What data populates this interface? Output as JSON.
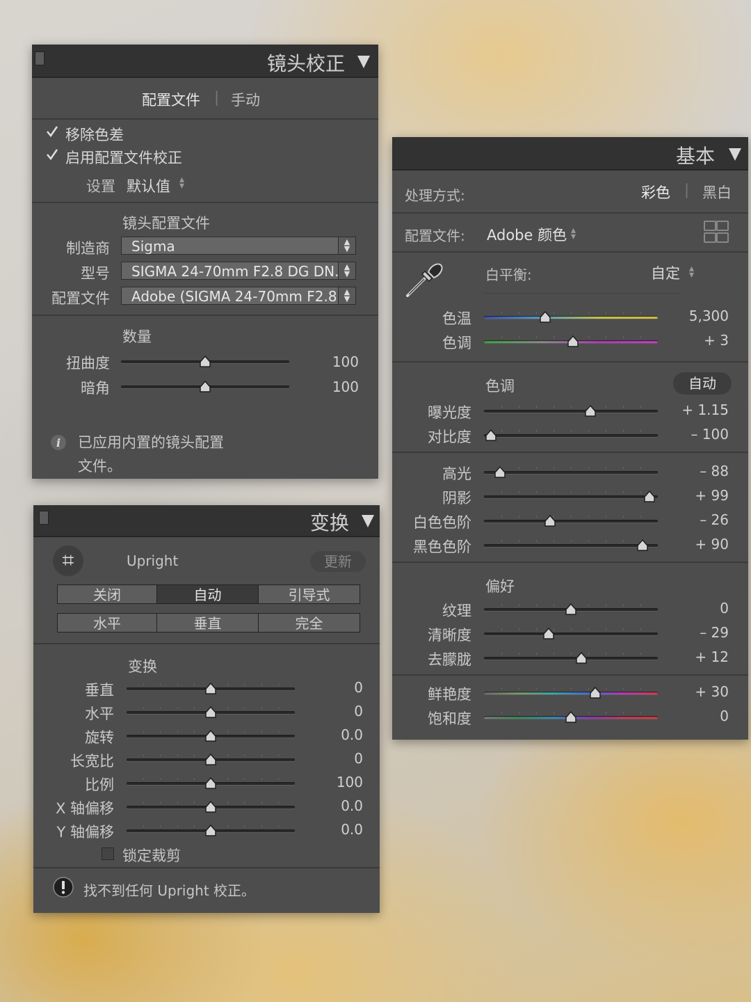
{
  "lens": {
    "title": "镜头校正",
    "tabs": [
      "配置文件",
      "手动"
    ],
    "remove_ca": "移除色差",
    "enable_profile": "启用配置文件校正",
    "setup_label": "设置",
    "setup_value": "默认值",
    "profile_heading": "镜头配置文件",
    "make_label": "制造商",
    "make_value": "Sigma",
    "model_label": "型号",
    "model_value": "SIGMA 24-70mm F2.8 DG DN...",
    "profile_label": "配置文件",
    "profile_value": "Adobe (SIGMA 24-70mm F2.8...",
    "amount_heading": "数量",
    "sliders": [
      {
        "label": "扭曲度",
        "value": "100",
        "pos": 0.5
      },
      {
        "label": "暗角",
        "value": "100",
        "pos": 0.5
      }
    ],
    "info": [
      "已应用内置的镜头配置",
      "文件。"
    ]
  },
  "transform": {
    "title": "变换",
    "upright_label": "Upright",
    "update_label": "更新",
    "buttons_row1": [
      "关闭",
      "自动",
      "引导式"
    ],
    "buttons_row2": [
      "水平",
      "垂直",
      "完全"
    ],
    "selected": "自动",
    "heading": "变换",
    "sliders": [
      {
        "label": "垂直",
        "value": "0",
        "pos": 0.5
      },
      {
        "label": "水平",
        "value": "0",
        "pos": 0.5
      },
      {
        "label": "旋转",
        "value": "0.0",
        "pos": 0.5
      },
      {
        "label": "长宽比",
        "value": "0",
        "pos": 0.5
      },
      {
        "label": "比例",
        "value": "100",
        "pos": 0.5
      },
      {
        "label": "X 轴偏移",
        "value": "0.0",
        "pos": 0.5
      },
      {
        "label": "Y 轴偏移",
        "value": "0.0",
        "pos": 0.5
      }
    ],
    "lock_crop": "锁定裁剪",
    "warning": "找不到任何 Upright 校正。"
  },
  "basic": {
    "title": "基本",
    "treatment_label": "处理方式:",
    "color_label": "彩色",
    "bw_label": "黑白",
    "profile_label": "配置文件:",
    "profile_value": "Adobe 颜色",
    "wb_label": "白平衡:",
    "wb_value": "自定",
    "wb_sliders": [
      {
        "label": "色温",
        "value": "5,300",
        "pos": 0.35
      },
      {
        "label": "色调",
        "value": "+ 3",
        "pos": 0.51
      }
    ],
    "tone_heading": "色调",
    "auto_label": "自动",
    "tone_sliders": [
      {
        "label": "曝光度",
        "value": "+ 1.15",
        "pos": 0.61
      },
      {
        "label": "对比度",
        "value": "– 100",
        "pos": 0.04
      }
    ],
    "presence_sliders": [
      {
        "label": "高光",
        "value": "– 88",
        "pos": 0.09
      },
      {
        "label": "阴影",
        "value": "+ 99",
        "pos": 0.95
      },
      {
        "label": "白色色阶",
        "value": "– 26",
        "pos": 0.38
      },
      {
        "label": "黑色色阶",
        "value": "+ 90",
        "pos": 0.91
      }
    ],
    "pref_heading": "偏好",
    "pref_sliders": [
      {
        "label": "纹理",
        "value": "0",
        "pos": 0.5
      },
      {
        "label": "清晰度",
        "value": "– 29",
        "pos": 0.37
      },
      {
        "label": "去朦胧",
        "value": "+ 12",
        "pos": 0.56
      }
    ],
    "color_sliders": [
      {
        "label": "鲜艳度",
        "value": "+ 30",
        "pos": 0.64
      },
      {
        "label": "饱和度",
        "value": "0",
        "pos": 0.5
      }
    ]
  }
}
